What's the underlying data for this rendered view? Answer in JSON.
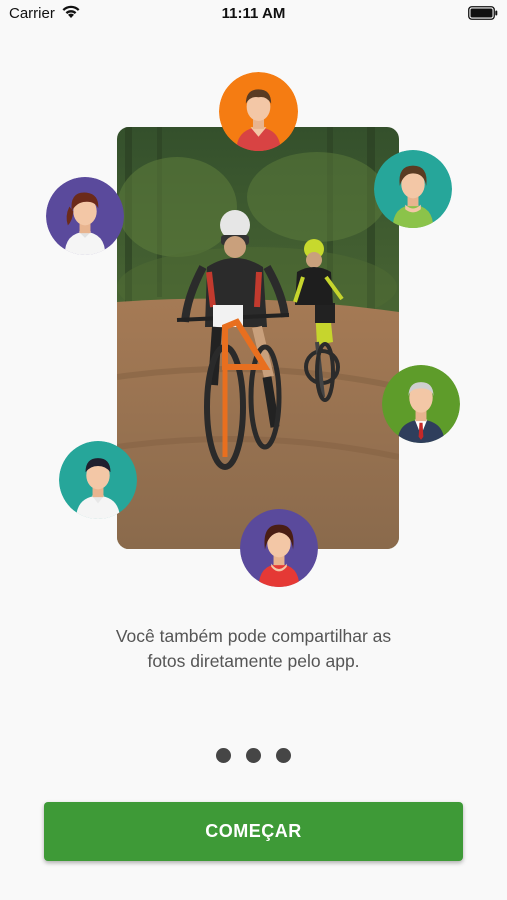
{
  "status_bar": {
    "carrier": "Carrier",
    "time": "11:11 AM"
  },
  "onboarding": {
    "caption_line1": "Você também pode compartilhar as",
    "caption_line2": "fotos diretamente pelo app.",
    "page_count": 3,
    "avatars": [
      {
        "name": "avatar-man-orange",
        "bg": "#f57c12"
      },
      {
        "name": "avatar-woman-teal",
        "bg": "#26a69a"
      },
      {
        "name": "avatar-woman-purple",
        "bg": "#5a4a9c"
      },
      {
        "name": "avatar-older-man-green",
        "bg": "#5e9c2a"
      },
      {
        "name": "avatar-man-teal",
        "bg": "#26a69a"
      },
      {
        "name": "avatar-woman-red-purple",
        "bg": "#5a4a9c"
      }
    ]
  },
  "cta": {
    "label": "COMEÇAR",
    "color": "#3e9a37"
  },
  "icons": [
    "wifi-icon",
    "battery-icon"
  ]
}
